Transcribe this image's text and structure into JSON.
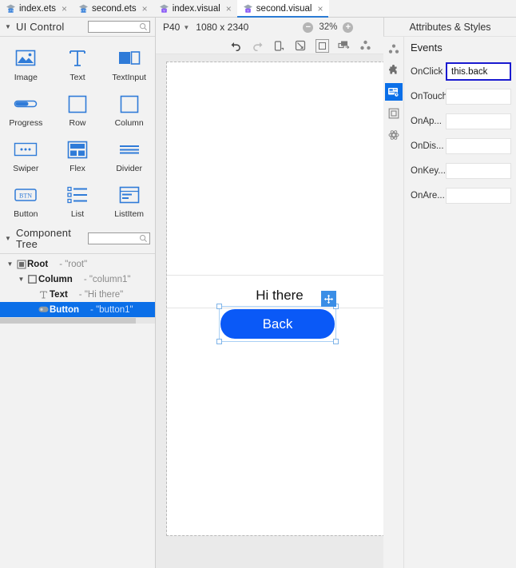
{
  "tabs": [
    {
      "label": "index.ets",
      "kind": "ets",
      "active": false,
      "close": "×"
    },
    {
      "label": "second.ets",
      "kind": "ets",
      "active": false,
      "close": "×"
    },
    {
      "label": "index.visual",
      "kind": "visual",
      "active": false,
      "close": "×"
    },
    {
      "label": "second.visual",
      "kind": "visual",
      "active": true,
      "close": "×"
    }
  ],
  "left": {
    "ui_control": {
      "title": "UI Control",
      "caret": "▼",
      "search_placeholder": "",
      "search_icon": "search-icon",
      "items": [
        {
          "label": "Image",
          "icon": "image-icon"
        },
        {
          "label": "Text",
          "icon": "text-icon"
        },
        {
          "label": "TextInput",
          "icon": "textinput-icon"
        },
        {
          "label": "Progress",
          "icon": "progress-icon"
        },
        {
          "label": "Row",
          "icon": "row-icon"
        },
        {
          "label": "Column",
          "icon": "column-icon"
        },
        {
          "label": "Swiper",
          "icon": "swiper-icon"
        },
        {
          "label": "Flex",
          "icon": "flex-icon"
        },
        {
          "label": "Divider",
          "icon": "divider-icon"
        },
        {
          "label": "Button",
          "icon": "button-icon"
        },
        {
          "label": "List",
          "icon": "list-icon"
        },
        {
          "label": "ListItem",
          "icon": "listitem-icon"
        }
      ]
    },
    "component_tree": {
      "title": "Component Tree",
      "caret": "▼",
      "search_placeholder": "",
      "rows": [
        {
          "name": "Root",
          "value": "- \"root\"",
          "icon": "root-icon",
          "caret": "▼",
          "indent": 0,
          "selected": false
        },
        {
          "name": "Column",
          "value": "- \"column1\"",
          "icon": "column-node-icon",
          "caret": "▼",
          "indent": 1,
          "selected": false
        },
        {
          "name": "Text",
          "value": "- \"Hi there\"",
          "icon": "text-node-icon",
          "caret": "",
          "indent": 2,
          "selected": false
        },
        {
          "name": "Button",
          "value": "- \"button1\"",
          "icon": "button-node-icon",
          "caret": "",
          "indent": 2,
          "selected": true
        }
      ]
    }
  },
  "toolbar": {
    "device": "P40",
    "device_caret": "⌄",
    "dimensions": "1080 x 2340",
    "zoom_out": "−",
    "zoom_value": "32%",
    "zoom_in": "+",
    "icons": [
      "undo-icon",
      "redo-icon",
      "device-rotate-icon",
      "pointer-resize-icon",
      "frame-icon",
      "component-add-icon",
      "nodes-icon"
    ]
  },
  "canvas": {
    "text_component": "Hi there",
    "button_component": "Back",
    "move_handle": "move-handle-icon",
    "button_color": "#0a59f7"
  },
  "right": {
    "header": "Attributes & Styles",
    "rail_icons": [
      "nodes-icon",
      "puzzle-icon",
      "events-icon",
      "layout-icon",
      "settings-icon"
    ],
    "section_title": "Events",
    "fields": [
      {
        "label": "OnClick",
        "value": "this.back",
        "focused": true
      },
      {
        "label": "OnTouch",
        "value": "",
        "focused": false
      },
      {
        "label": "OnAp...",
        "value": "",
        "focused": false
      },
      {
        "label": "OnDis...",
        "value": "",
        "focused": false
      },
      {
        "label": "OnKey...",
        "value": "",
        "focused": false
      },
      {
        "label": "OnAre...",
        "value": "",
        "focused": false
      }
    ]
  }
}
